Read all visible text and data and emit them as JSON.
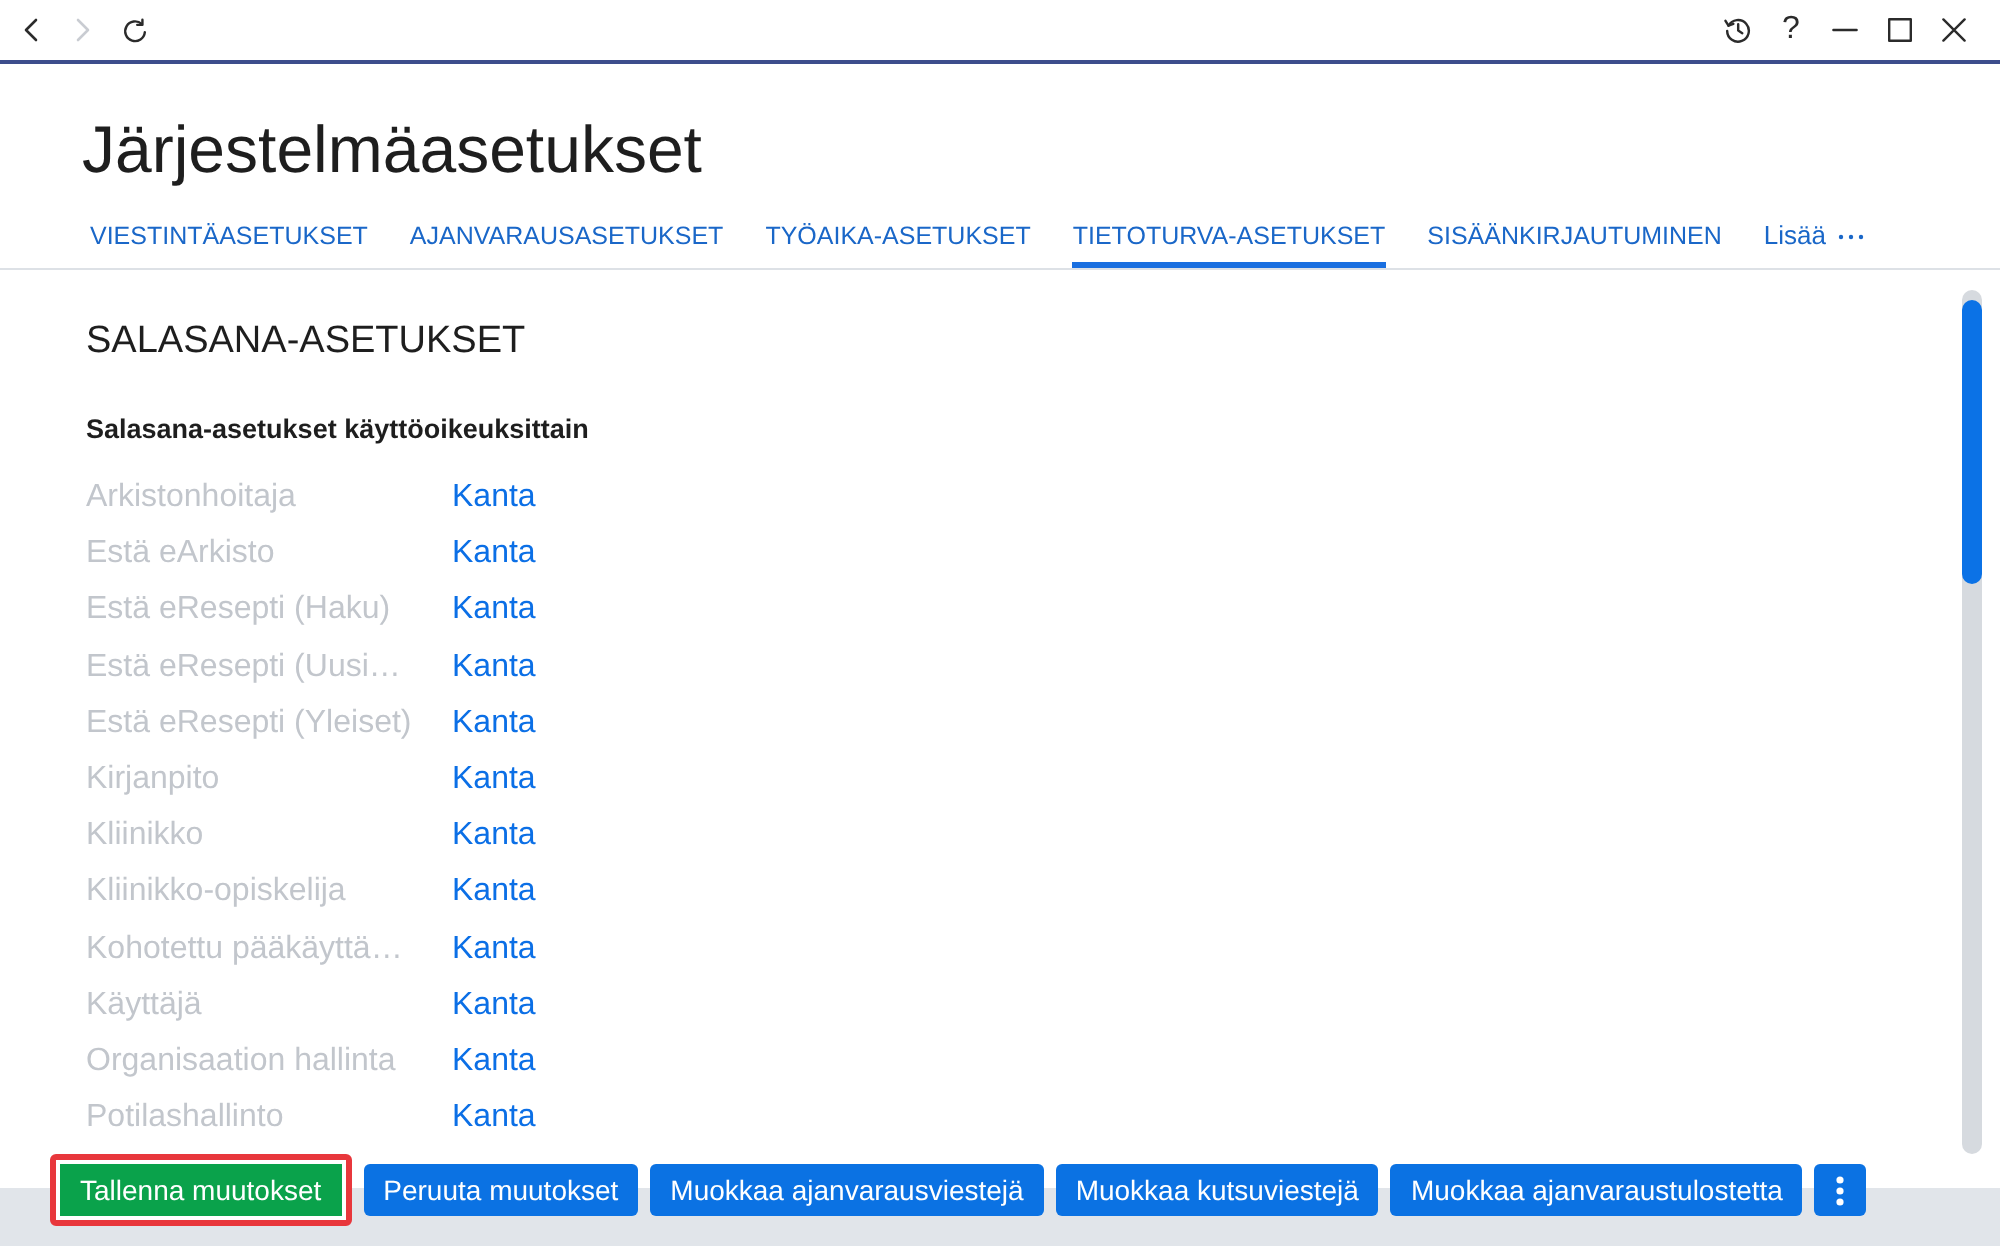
{
  "nav": [
    {
      "kind": "back",
      "disabled": false
    },
    {
      "kind": "forward",
      "disabled": true
    },
    {
      "kind": "refresh",
      "disabled": false
    }
  ],
  "window_controls": [
    {
      "kind": "history"
    },
    {
      "kind": "help",
      "label": "?"
    },
    {
      "kind": "minimize"
    },
    {
      "kind": "maximize"
    },
    {
      "kind": "close"
    }
  ],
  "page": {
    "title": "Järjestelmäasetukset"
  },
  "tabs": [
    {
      "label": "VIESTINTÄASETUKSET",
      "selected": false
    },
    {
      "label": "AJANVARAUSASETUKSET",
      "selected": false
    },
    {
      "label": "TYÖAIKA-ASETUKSET",
      "selected": false
    },
    {
      "label": "TIETOTURVA-ASETUKSET",
      "selected": true
    },
    {
      "label": "SISÄÄNKIRJAUTUMINEN",
      "selected": false
    }
  ],
  "more_tab": {
    "label": "Lisää"
  },
  "section": {
    "title": "SALASANA-ASETUKSET",
    "subtitle": "Salasana-asetukset käyttöoikeuksittain",
    "rows": [
      {
        "role": "Arkistonhoitaja",
        "value": "Kanta",
        "disabled": true
      },
      {
        "role": "Estä eArkisto",
        "value": "Kanta",
        "disabled": true
      },
      {
        "role": "Estä eResepti (Haku)",
        "value": "Kanta",
        "disabled": true
      },
      {
        "role": "Estä eResepti (Uusi…",
        "value": "Kanta",
        "disabled": true
      },
      {
        "role": "Estä eResepti (Yleiset)",
        "value": "Kanta",
        "disabled": true
      },
      {
        "role": "Kirjanpito",
        "value": "Kanta",
        "disabled": true
      },
      {
        "role": "Kliinikko",
        "value": "Kanta",
        "disabled": true
      },
      {
        "role": "Kliinikko-opiskelija",
        "value": "Kanta",
        "disabled": true
      },
      {
        "role": "Kohotettu pääkäyttä…",
        "value": "Kanta",
        "disabled": true
      },
      {
        "role": "Käyttäjä",
        "value": "Kanta",
        "disabled": true
      },
      {
        "role": "Organisaation hallinta",
        "value": "Kanta",
        "disabled": true
      },
      {
        "role": "Potilashallinto",
        "value": "Kanta",
        "disabled": true
      }
    ]
  },
  "buttons": [
    {
      "kind": "success",
      "label": "Tallenna muutokset",
      "highlighted": true
    },
    {
      "kind": "primary",
      "label": "Peruuta muutokset",
      "highlighted": false
    },
    {
      "kind": "primary",
      "label": "Muokkaa ajanvarausviestejä",
      "highlighted": false
    },
    {
      "kind": "primary",
      "label": "Muokkaa kutsuviestejä",
      "highlighted": false
    },
    {
      "kind": "primary",
      "label": "Muokkaa ajanvaraustulostetta",
      "highlighted": false
    },
    {
      "kind": "more",
      "highlighted": false
    }
  ]
}
